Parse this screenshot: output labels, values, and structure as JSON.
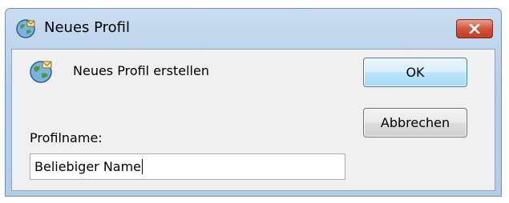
{
  "window": {
    "title": "Neues Profil"
  },
  "dialog": {
    "heading": "Neues Profil erstellen",
    "profile_label": "Profilname:",
    "profile_value": "Beliebiger Name"
  },
  "buttons": {
    "ok": "OK",
    "cancel": "Abbrechen"
  },
  "icons": {
    "app": "mail-globe-icon",
    "close": "close-icon"
  },
  "colors": {
    "close_button": "#c43c22",
    "title_bar": "#b9d1ea",
    "default_button_border": "#3c7fb1"
  }
}
